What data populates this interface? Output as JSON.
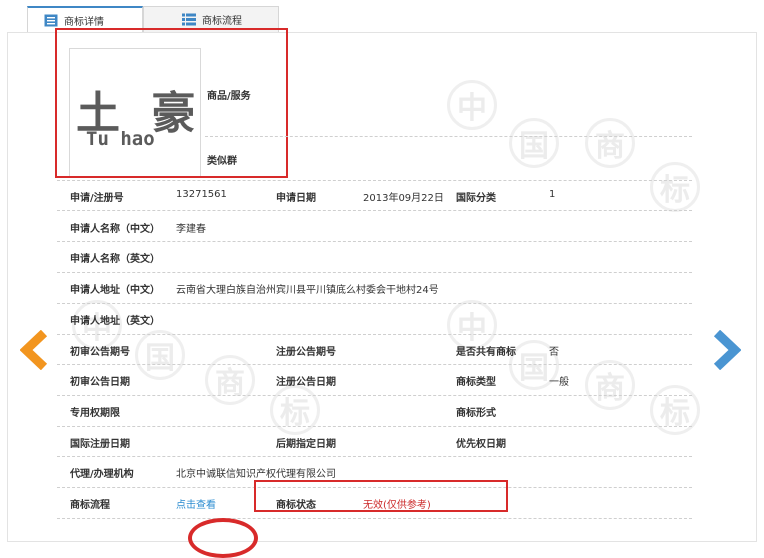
{
  "tabs": [
    {
      "label": "商标详情",
      "icon": "document-icon",
      "active": true
    },
    {
      "label": "商标流程",
      "icon": "list-icon",
      "active": false
    }
  ],
  "watermark_chars": [
    "中",
    "国",
    "商",
    "标"
  ],
  "trademark": {
    "logo_cn": "土 豪",
    "logo_en": "Tu hao",
    "goods_label": "商品/服务",
    "similar_group_label": "类似群"
  },
  "fields": {
    "reg_no_label": "申请/注册号",
    "reg_no": "13271561",
    "apply_date_label": "申请日期",
    "apply_date": "2013年09月22日",
    "intl_class_label": "国际分类",
    "intl_class": "1",
    "applicant_cn_label": "申请人名称（中文）",
    "applicant_cn": "李建春",
    "applicant_en_label": "申请人名称（英文）",
    "addr_cn_label": "申请人地址（中文）",
    "addr_cn": "云南省大理白族自治州宾川县平川镇底么村委会干地村24号",
    "addr_en_label": "申请人地址（英文）",
    "prelim_no_label": "初审公告期号",
    "reg_pub_no_label": "注册公告期号",
    "shared_label": "是否共有商标",
    "shared": "否",
    "prelim_date_label": "初审公告日期",
    "reg_pub_date_label": "注册公告日期",
    "tm_type_label": "商标类型",
    "tm_type": "一般",
    "exclusive_label": "专用权期限",
    "tm_form_label": "商标形式",
    "intl_reg_date_label": "国际注册日期",
    "later_date_label": "后期指定日期",
    "priority_date_label": "优先权日期",
    "agent_label": "代理/办理机构",
    "agent": "北京中诚联信知识产权代理有限公司",
    "process_label": "商标流程",
    "process_link": "点击查看",
    "status_label": "商标状态",
    "status_main": "无效",
    "status_note": "(仅供参考)"
  },
  "colors": {
    "accent": "#3f87c5",
    "highlight_box": "#d82a2a",
    "prev_arrow": "#f2951f",
    "next_arrow": "#4a95d2",
    "link": "#2a8bd0"
  }
}
